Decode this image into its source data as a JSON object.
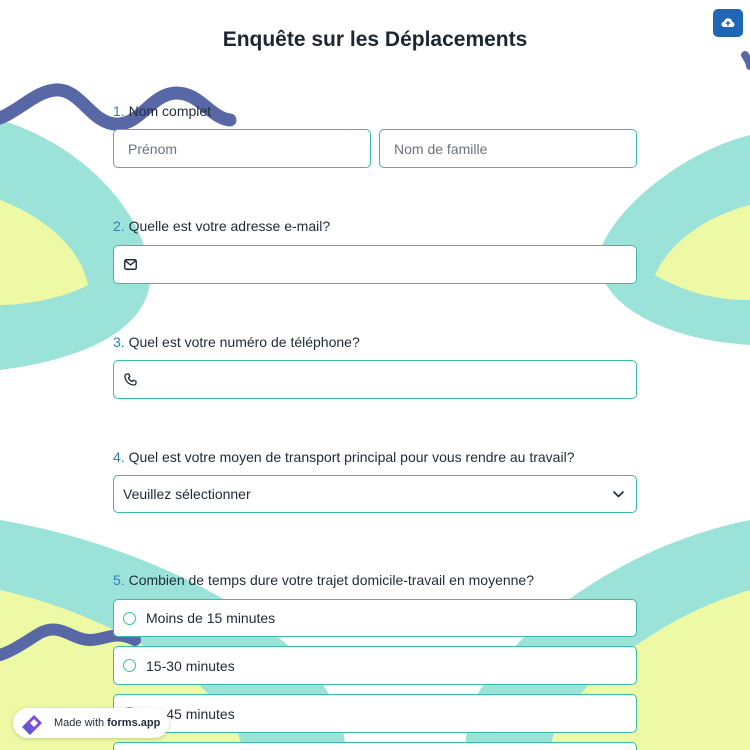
{
  "form": {
    "title": "Enquête sur les Déplacements"
  },
  "questions": [
    {
      "number": "1.",
      "label": "Nom complet",
      "first_placeholder": "Prénom",
      "last_placeholder": "Nom de famille"
    },
    {
      "number": "2.",
      "label": "Quelle est votre adresse e-mail?",
      "icon": "envelope-icon"
    },
    {
      "number": "3.",
      "label": "Quel est votre numéro de téléphone?",
      "icon": "phone-icon"
    },
    {
      "number": "4.",
      "label": "Quel est votre moyen de transport principal pour vous rendre au travail?",
      "select_value": "Veuillez sélectionner"
    },
    {
      "number": "5.",
      "label": "Combien de temps dure votre trajet domicile-travail en moyenne?",
      "options": [
        "Moins de 15 minutes",
        "15-30 minutes",
        "30-45 minutes"
      ]
    }
  ],
  "footer": {
    "made_with": "Made with",
    "brand": "forms.app"
  },
  "colors": {
    "accent": "#3cbca6",
    "number": "#2f7fb8",
    "upload_button": "#1f66b5",
    "teal_shape": "#9be3d8",
    "yellow_shape": "#eef9a5",
    "squiggle": "#5868a6"
  }
}
